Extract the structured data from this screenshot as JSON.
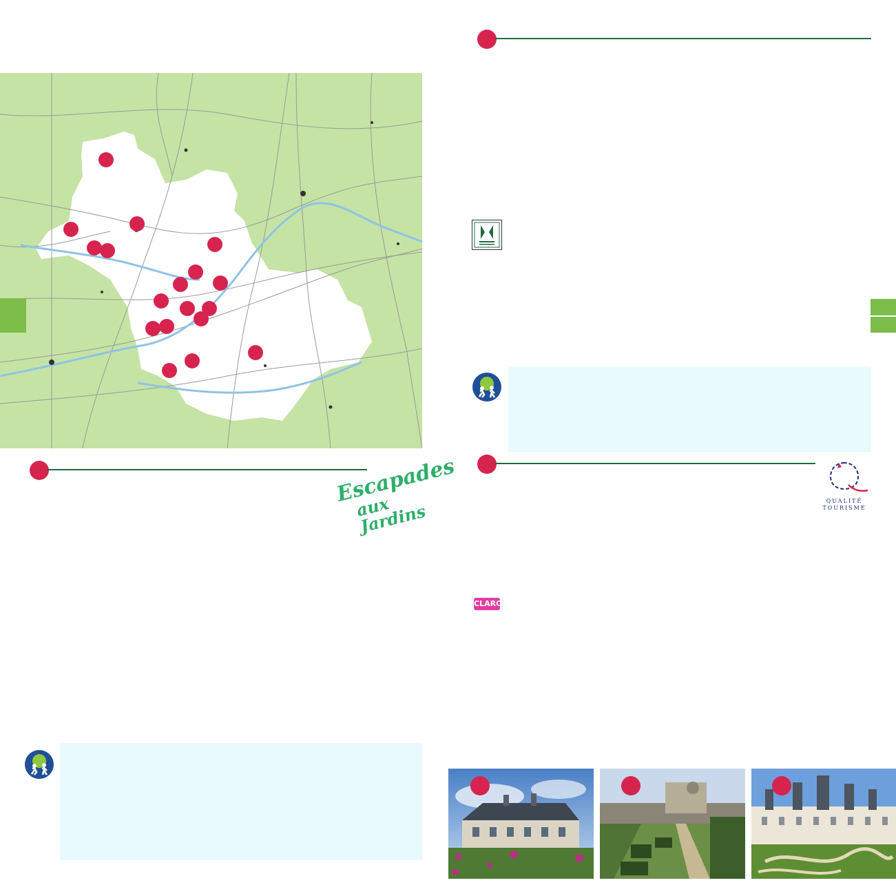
{
  "colors": {
    "marker": "#d6244f",
    "rule": "#1f6b3e",
    "map_green": "#c5e3a4",
    "map_region": "#ffffff",
    "river": "#8fc3e6",
    "tab_green": "#7dbd4a",
    "info_bg": "#e8fafd",
    "logo_green": "#2fae6a",
    "clarc_pink": "#e23c9e"
  },
  "logos": {
    "escapades_line1": "Escapades",
    "escapades_line2": "aux Jardins",
    "qualite": "QUALITÉ",
    "tourisme": "TOURISME",
    "clarc": "CLARC",
    "jardin_remarquable_icon": "jardin-remarquable-icon",
    "family_icon": "family-tree-icon"
  },
  "icons": {
    "section_marker": "red-circle-icon",
    "map_marker": "map-pin-dot-icon"
  }
}
